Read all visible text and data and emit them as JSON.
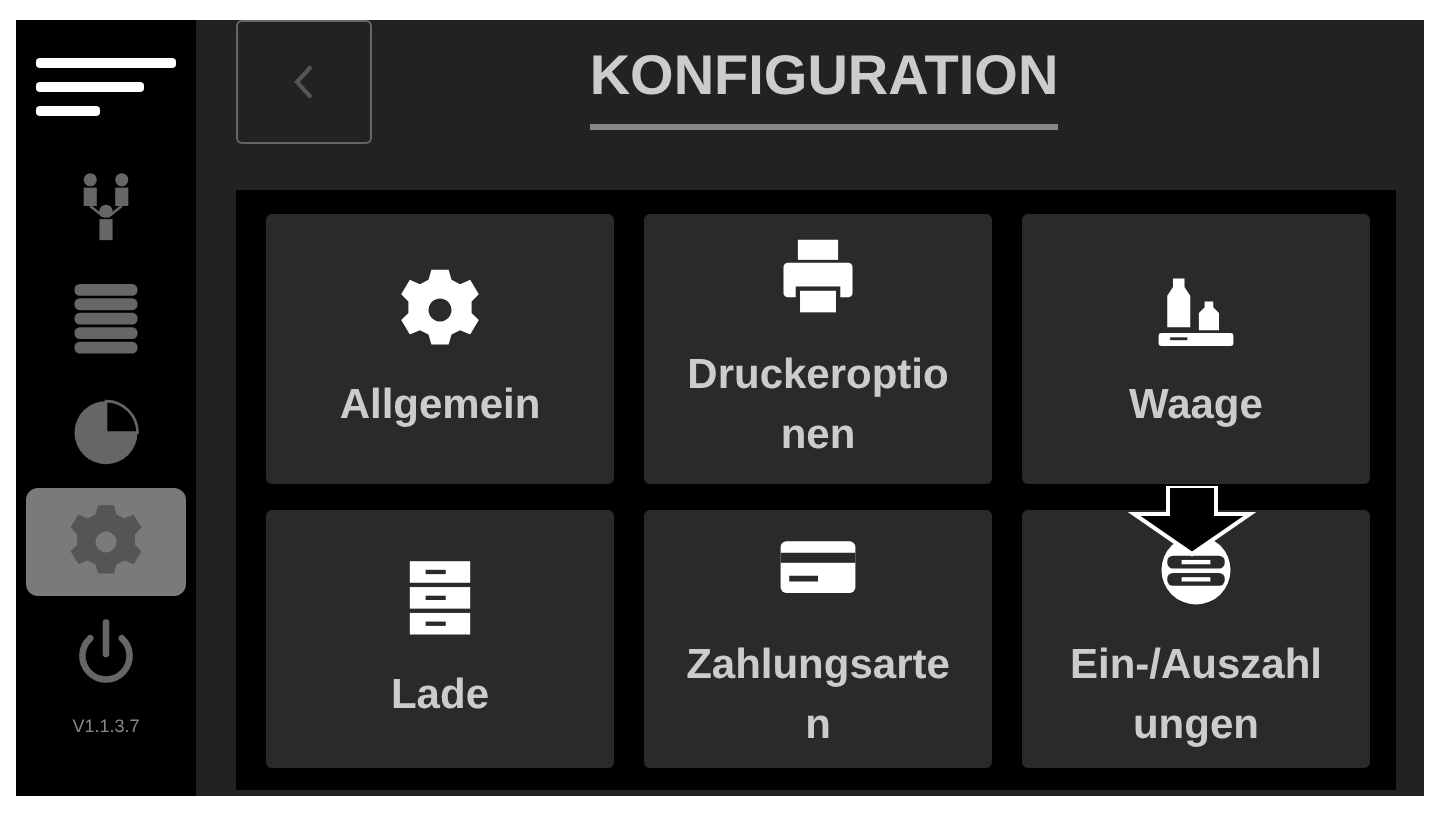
{
  "header": {
    "title": "KONFIGURATION"
  },
  "sidebar": {
    "items": [
      {
        "kind": "people",
        "selected": false
      },
      {
        "kind": "coins",
        "selected": false
      },
      {
        "kind": "pie",
        "selected": false
      },
      {
        "kind": "gear",
        "selected": true
      },
      {
        "kind": "power",
        "selected": false
      }
    ],
    "version": "V1.1.3.7"
  },
  "tiles": [
    {
      "kind": "gear",
      "label": "Allgemein"
    },
    {
      "kind": "printer",
      "label": "Druckeroptio\nnen"
    },
    {
      "kind": "scale",
      "label": "Waage"
    },
    {
      "kind": "drawer",
      "label": "Lade"
    },
    {
      "kind": "card",
      "label": "Zahlungsarte\nn"
    },
    {
      "kind": "cash",
      "label": "Ein-/Auszahl\nungen"
    }
  ]
}
